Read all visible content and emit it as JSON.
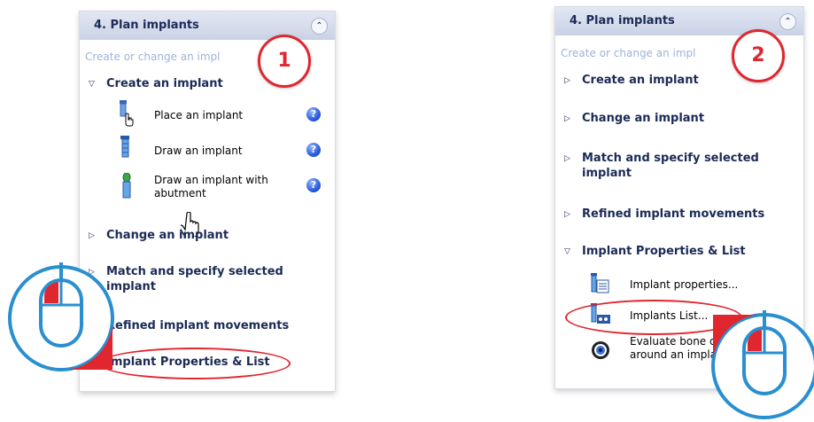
{
  "colors": {
    "accent_red": "#e0262f",
    "mouse_blue": "#2a8fd0",
    "title_navy": "#1b2a56",
    "subtitle_blue": "#9fb3d8"
  },
  "left_panel": {
    "title": "4. Plan implants",
    "subtitle": "Create or change an impl",
    "callout": "1",
    "sections": {
      "create": "Create an implant",
      "change": "Change an implant",
      "match": "Match and specify selected implant",
      "refined": "Refined implant movements",
      "props": "Implant Properties & List"
    },
    "items": {
      "place": "Place an implant",
      "draw": "Draw an implant",
      "draw_abutment": "Draw an implant with abutment"
    },
    "icons": {
      "place": "implant-hand-icon",
      "draw": "implant-icon",
      "abutment": "implant-abutment-icon",
      "help": "help-icon",
      "cursor": "hand-cursor-icon",
      "mouse": "mouse-left-click-icon"
    }
  },
  "right_panel": {
    "title": "4. Plan implants",
    "subtitle": "Create or change an impl",
    "callout": "2",
    "sections": {
      "create": "Create an implant",
      "change": "Change an implant",
      "match": "Match and specify selected implant",
      "refined": "Refined implant movements",
      "props": "Implant Properties & List"
    },
    "items": {
      "properties": "Implant properties...",
      "list": "Implants List...",
      "evaluate": "Evaluate bone de around an implan"
    },
    "icons": {
      "properties": "implant-properties-icon",
      "list": "implants-list-icon",
      "evaluate": "bone-density-icon",
      "mouse": "mouse-left-click-icon"
    }
  }
}
